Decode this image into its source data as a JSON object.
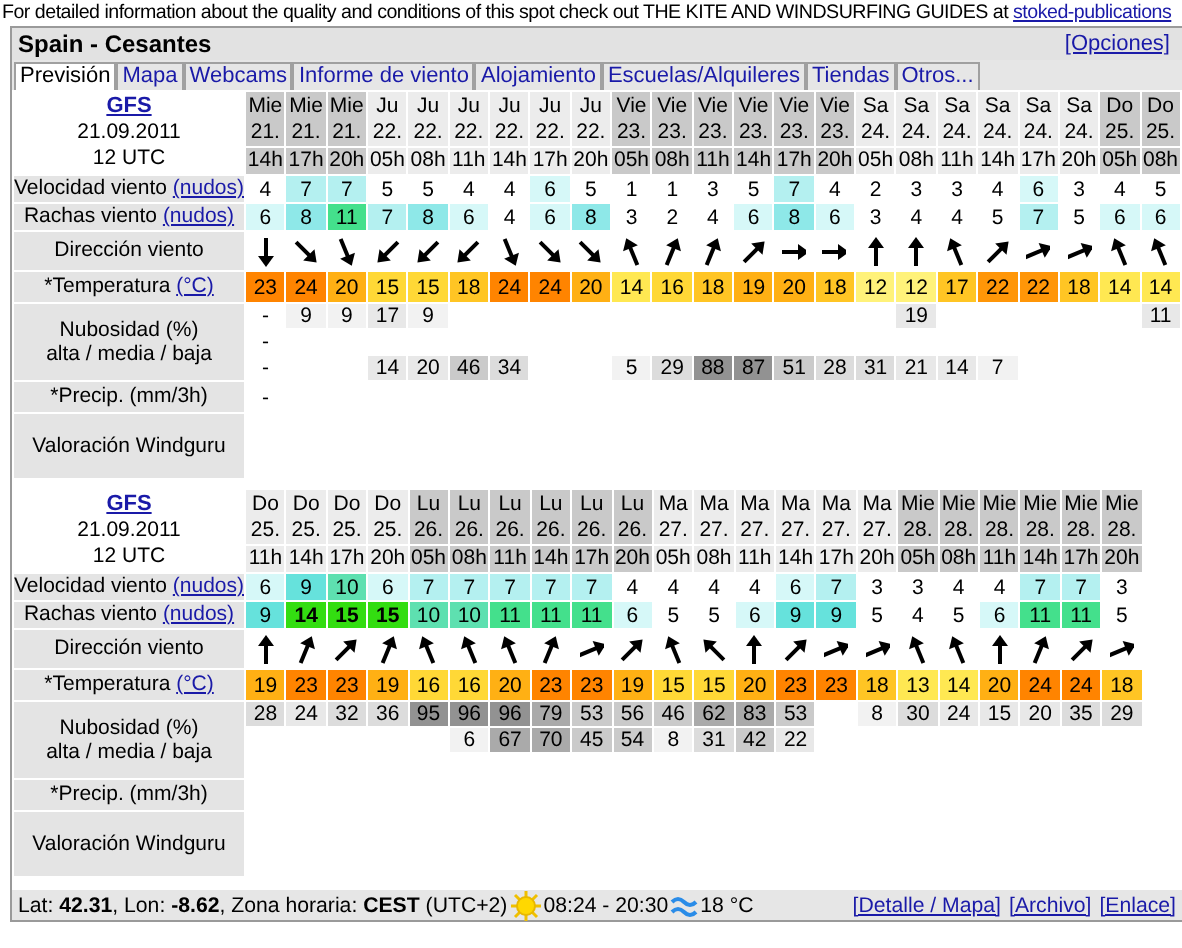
{
  "intro": {
    "text": "For detailed information about the quality and conditions of this spot check out THE KITE AND WINDSURFING GUIDES at ",
    "link": "stoked-publications"
  },
  "spot_title": "Spain - Cesantes",
  "options_link": "[Opciones]",
  "tabs": [
    {
      "label": "Previsión",
      "selected": true
    },
    {
      "label": "Mapa",
      "selected": false
    },
    {
      "label": "Webcams",
      "selected": false
    },
    {
      "label": "Informe de viento",
      "selected": false
    },
    {
      "label": "Alojamiento",
      "selected": false
    },
    {
      "label": "Escuelas/Alquileres",
      "selected": false
    },
    {
      "label": "Tiendas",
      "selected": false
    },
    {
      "label": "Otros...",
      "selected": false
    }
  ],
  "forecasts": [
    {
      "model": "GFS",
      "run_date": "21.09.2011",
      "run_time": "12 UTC",
      "labels": {
        "speed": "Velocidad viento",
        "speed_unit": "(nudos)",
        "gust": "Rachas viento",
        "gust_unit": "(nudos)",
        "direction": "Dirección viento",
        "temperature": "*Temperatura",
        "temp_unit": "(°C)",
        "clouds": "Nubosidad (%)",
        "clouds_levels": "alta / media / baja",
        "precip": "*Precip. (mm/3h)",
        "rating": "Valoración Windguru"
      },
      "columns": [
        {
          "day": "Mie",
          "date": "21.",
          "hour": "14h",
          "shaded": true,
          "speed": "4",
          "gust": "6",
          "arrow": {
            "kind": "S"
          },
          "temp": "23",
          "high": "-",
          "mid": "-",
          "low": "-",
          "precip": "-"
        },
        {
          "day": "Mie",
          "date": "21.",
          "hour": "17h",
          "shaded": true,
          "speed": "7",
          "gust": "8",
          "arrow": {
            "kind": "SE"
          },
          "temp": "24",
          "high": "9"
        },
        {
          "day": "Mie",
          "date": "21.",
          "hour": "20h",
          "shaded": true,
          "speed": "7",
          "gust": "11",
          "arrow": {
            "kind": "SSE"
          },
          "temp": "20",
          "high": "9"
        },
        {
          "day": "Ju",
          "date": "22.",
          "hour": "05h",
          "shaded": false,
          "speed": "5",
          "gust": "7",
          "arrow": {
            "kind": "SW"
          },
          "temp": "15",
          "high": "17",
          "low": "14"
        },
        {
          "day": "Ju",
          "date": "22.",
          "hour": "08h",
          "shaded": false,
          "speed": "5",
          "gust": "8",
          "arrow": {
            "kind": "SW"
          },
          "temp": "15",
          "high": "9",
          "low": "20"
        },
        {
          "day": "Ju",
          "date": "22.",
          "hour": "11h",
          "shaded": false,
          "speed": "4",
          "gust": "6",
          "arrow": {
            "kind": "SW"
          },
          "temp": "18",
          "low": "46"
        },
        {
          "day": "Ju",
          "date": "22.",
          "hour": "14h",
          "shaded": false,
          "speed": "4",
          "gust": "4",
          "arrow": {
            "kind": "SSE"
          },
          "temp": "24",
          "low": "34"
        },
        {
          "day": "Ju",
          "date": "22.",
          "hour": "17h",
          "shaded": false,
          "speed": "6",
          "gust": "6",
          "arrow": {
            "kind": "SE"
          },
          "temp": "24"
        },
        {
          "day": "Ju",
          "date": "22.",
          "hour": "20h",
          "shaded": false,
          "speed": "5",
          "gust": "8",
          "arrow": {
            "kind": "SE"
          },
          "temp": "20"
        },
        {
          "day": "Vie",
          "date": "23.",
          "hour": "05h",
          "shaded": true,
          "speed": "1",
          "gust": "3",
          "arrow": {
            "kind": "NNW"
          },
          "temp": "14",
          "low": "5"
        },
        {
          "day": "Vie",
          "date": "23.",
          "hour": "08h",
          "shaded": true,
          "speed": "1",
          "gust": "2",
          "arrow": {
            "kind": "NNE"
          },
          "temp": "16",
          "low": "29"
        },
        {
          "day": "Vie",
          "date": "23.",
          "hour": "11h",
          "shaded": true,
          "speed": "3",
          "gust": "4",
          "arrow": {
            "kind": "NNE"
          },
          "temp": "18",
          "low": "88"
        },
        {
          "day": "Vie",
          "date": "23.",
          "hour": "14h",
          "shaded": true,
          "speed": "5",
          "gust": "6",
          "arrow": {
            "kind": "NE"
          },
          "temp": "19",
          "low": "87"
        },
        {
          "day": "Vie",
          "date": "23.",
          "hour": "17h",
          "shaded": true,
          "speed": "7",
          "gust": "8",
          "arrow": {
            "kind": "E"
          },
          "temp": "20",
          "low": "51"
        },
        {
          "day": "Vie",
          "date": "23.",
          "hour": "20h",
          "shaded": true,
          "speed": "4",
          "gust": "6",
          "arrow": {
            "kind": "E"
          },
          "temp": "18",
          "low": "28"
        },
        {
          "day": "Sa",
          "date": "24.",
          "hour": "05h",
          "shaded": false,
          "speed": "2",
          "gust": "3",
          "arrow": {
            "kind": "N"
          },
          "temp": "12",
          "low": "31"
        },
        {
          "day": "Sa",
          "date": "24.",
          "hour": "08h",
          "shaded": false,
          "speed": "3",
          "gust": "4",
          "arrow": {
            "kind": "N"
          },
          "temp": "12",
          "high": "19",
          "low": "21"
        },
        {
          "day": "Sa",
          "date": "24.",
          "hour": "11h",
          "shaded": false,
          "speed": "3",
          "gust": "4",
          "arrow": {
            "kind": "NNW"
          },
          "temp": "17",
          "low": "14"
        },
        {
          "day": "Sa",
          "date": "24.",
          "hour": "14h",
          "shaded": false,
          "speed": "4",
          "gust": "5",
          "arrow": {
            "kind": "NE"
          },
          "temp": "22",
          "low": "7"
        },
        {
          "day": "Sa",
          "date": "24.",
          "hour": "17h",
          "shaded": false,
          "speed": "6",
          "gust": "7",
          "arrow": {
            "kind": "ENE"
          },
          "temp": "22"
        },
        {
          "day": "Sa",
          "date": "24.",
          "hour": "20h",
          "shaded": false,
          "speed": "3",
          "gust": "5",
          "arrow": {
            "kind": "ENE"
          },
          "temp": "18"
        },
        {
          "day": "Do",
          "date": "25.",
          "hour": "05h",
          "shaded": true,
          "speed": "4",
          "gust": "6",
          "arrow": {
            "kind": "NNW"
          },
          "temp": "14"
        },
        {
          "day": "Do",
          "date": "25.",
          "hour": "08h",
          "shaded": true,
          "speed": "5",
          "gust": "6",
          "arrow": {
            "kind": "NNW"
          },
          "temp": "14",
          "high": "11"
        }
      ]
    },
    {
      "model": "GFS",
      "run_date": "21.09.2011",
      "run_time": "12 UTC",
      "labels": {
        "speed": "Velocidad viento",
        "speed_unit": "(nudos)",
        "gust": "Rachas viento",
        "gust_unit": "(nudos)",
        "direction": "Dirección viento",
        "temperature": "*Temperatura",
        "temp_unit": "(°C)",
        "clouds": "Nubosidad (%)",
        "clouds_levels": "alta / media / baja",
        "precip": "*Precip. (mm/3h)",
        "rating": "Valoración Windguru"
      },
      "columns": [
        {
          "day": "Do",
          "date": "25.",
          "hour": "11h",
          "shaded": false,
          "speed": "6",
          "gust": "9",
          "arrow": {
            "kind": "N"
          },
          "temp": "19",
          "high": "28"
        },
        {
          "day": "Do",
          "date": "25.",
          "hour": "14h",
          "shaded": false,
          "speed": "9",
          "gust": "14",
          "arrow": {
            "kind": "NNE"
          },
          "temp": "23",
          "high": "24"
        },
        {
          "day": "Do",
          "date": "25.",
          "hour": "17h",
          "shaded": false,
          "speed": "10",
          "gust": "15",
          "arrow": {
            "kind": "NE"
          },
          "temp": "23",
          "high": "32"
        },
        {
          "day": "Do",
          "date": "25.",
          "hour": "20h",
          "shaded": false,
          "speed": "6",
          "gust": "15",
          "arrow": {
            "kind": "NNE"
          },
          "temp": "19",
          "high": "36"
        },
        {
          "day": "Lu",
          "date": "26.",
          "hour": "05h",
          "shaded": true,
          "speed": "7",
          "gust": "10",
          "arrow": {
            "kind": "NNW"
          },
          "temp": "16",
          "high": "95"
        },
        {
          "day": "Lu",
          "date": "26.",
          "hour": "08h",
          "shaded": true,
          "speed": "7",
          "gust": "10",
          "arrow": {
            "kind": "NNW"
          },
          "temp": "16",
          "high": "96",
          "mid": "6"
        },
        {
          "day": "Lu",
          "date": "26.",
          "hour": "11h",
          "shaded": true,
          "speed": "7",
          "gust": "11",
          "arrow": {
            "kind": "NNW"
          },
          "temp": "20",
          "high": "96",
          "mid": "67"
        },
        {
          "day": "Lu",
          "date": "26.",
          "hour": "14h",
          "shaded": true,
          "speed": "7",
          "gust": "11",
          "arrow": {
            "kind": "NNE"
          },
          "temp": "23",
          "high": "79",
          "mid": "70"
        },
        {
          "day": "Lu",
          "date": "26.",
          "hour": "17h",
          "shaded": true,
          "speed": "7",
          "gust": "11",
          "arrow": {
            "kind": "ENE"
          },
          "temp": "23",
          "high": "53",
          "mid": "45"
        },
        {
          "day": "Lu",
          "date": "26.",
          "hour": "20h",
          "shaded": true,
          "speed": "4",
          "gust": "6",
          "arrow": {
            "kind": "NE"
          },
          "temp": "19",
          "high": "56",
          "mid": "54"
        },
        {
          "day": "Ma",
          "date": "27.",
          "hour": "05h",
          "shaded": false,
          "speed": "4",
          "gust": "5",
          "arrow": {
            "kind": "NNW"
          },
          "temp": "15",
          "high": "46",
          "mid": "8"
        },
        {
          "day": "Ma",
          "date": "27.",
          "hour": "08h",
          "shaded": false,
          "speed": "4",
          "gust": "5",
          "arrow": {
            "kind": "NW"
          },
          "temp": "15",
          "high": "62",
          "mid": "31"
        },
        {
          "day": "Ma",
          "date": "27.",
          "hour": "11h",
          "shaded": false,
          "speed": "4",
          "gust": "6",
          "arrow": {
            "kind": "N"
          },
          "temp": "20",
          "high": "83",
          "mid": "42"
        },
        {
          "day": "Ma",
          "date": "27.",
          "hour": "14h",
          "shaded": false,
          "speed": "6",
          "gust": "9",
          "arrow": {
            "kind": "NE"
          },
          "temp": "23",
          "high": "53",
          "mid": "22"
        },
        {
          "day": "Ma",
          "date": "27.",
          "hour": "17h",
          "shaded": false,
          "speed": "7",
          "gust": "9",
          "arrow": {
            "kind": "ENE"
          },
          "temp": "23"
        },
        {
          "day": "Ma",
          "date": "27.",
          "hour": "20h",
          "shaded": false,
          "speed": "3",
          "gust": "5",
          "arrow": {
            "kind": "ENE"
          },
          "temp": "18",
          "high": "8"
        },
        {
          "day": "Mie",
          "date": "28.",
          "hour": "05h",
          "shaded": true,
          "speed": "3",
          "gust": "4",
          "arrow": {
            "kind": "NNW"
          },
          "temp": "13",
          "high": "30"
        },
        {
          "day": "Mie",
          "date": "28.",
          "hour": "08h",
          "shaded": true,
          "speed": "4",
          "gust": "5",
          "arrow": {
            "kind": "NNW"
          },
          "temp": "14",
          "high": "24"
        },
        {
          "day": "Mie",
          "date": "28.",
          "hour": "11h",
          "shaded": true,
          "speed": "4",
          "gust": "6",
          "arrow": {
            "kind": "N"
          },
          "temp": "20",
          "high": "15"
        },
        {
          "day": "Mie",
          "date": "28.",
          "hour": "14h",
          "shaded": true,
          "speed": "7",
          "gust": "11",
          "arrow": {
            "kind": "NNE"
          },
          "temp": "24",
          "high": "20"
        },
        {
          "day": "Mie",
          "date": "28.",
          "hour": "17h",
          "shaded": true,
          "speed": "7",
          "gust": "11",
          "arrow": {
            "kind": "NE"
          },
          "temp": "24",
          "high": "35"
        },
        {
          "day": "Mie",
          "date": "28.",
          "hour": "20h",
          "shaded": true,
          "speed": "3",
          "gust": "5",
          "arrow": {
            "kind": "ENE"
          },
          "temp": "18",
          "high": "29"
        }
      ]
    }
  ],
  "footer": {
    "location": "Lat: **42.31**, Lon: **-8.62**, Zona horaria: **CEST** (UTC+2)",
    "sun_times": "08:24 - 20:30",
    "sea_temp": "18 °C",
    "links": [
      "[Detalle / Mapa]",
      "[Archivo]",
      "[Enlace]"
    ]
  }
}
